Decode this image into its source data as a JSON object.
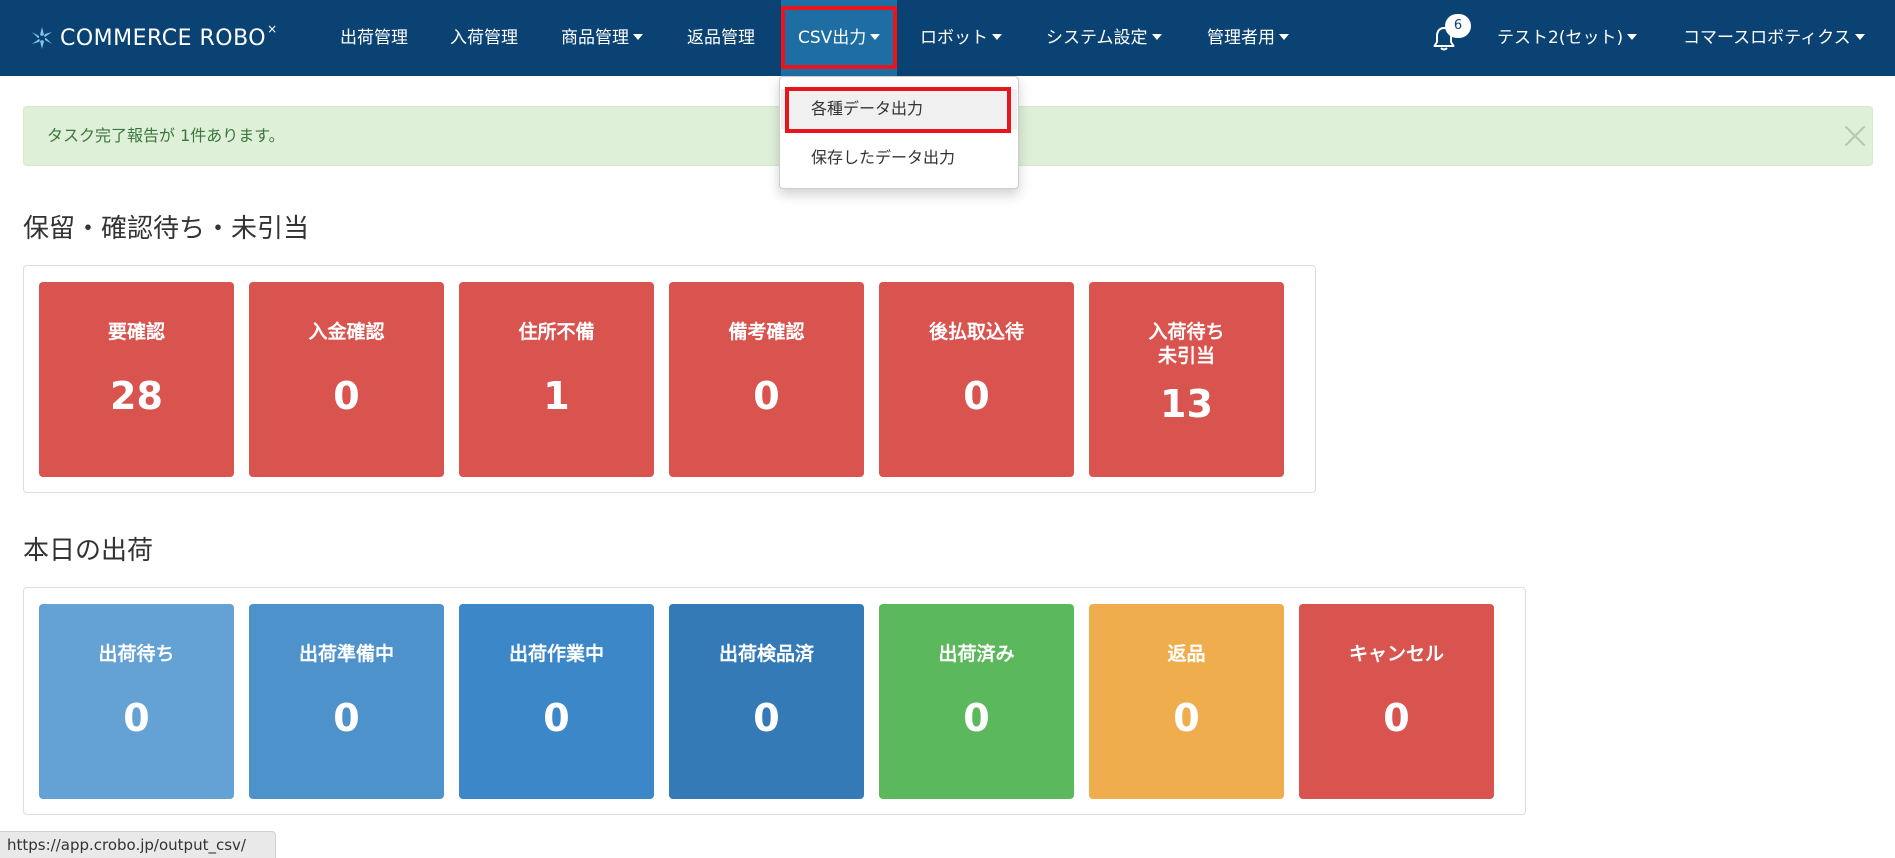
{
  "brand": {
    "name": "COMMERCE ROBO",
    "mark": "×"
  },
  "nav": {
    "items": [
      {
        "label": "出荷管理",
        "dropdown": false
      },
      {
        "label": "入荷管理",
        "dropdown": false
      },
      {
        "label": "商品管理",
        "dropdown": true
      },
      {
        "label": "返品管理",
        "dropdown": false
      },
      {
        "label": "CSV出力",
        "dropdown": true,
        "active": true
      },
      {
        "label": "ロボット",
        "dropdown": true
      },
      {
        "label": "システム設定",
        "dropdown": true
      },
      {
        "label": "管理者用",
        "dropdown": true
      }
    ],
    "notification_count": "6",
    "user": "テスト2(セット)",
    "company": "コマースロボティクス"
  },
  "csv_dropdown": {
    "items": [
      "各種データ出力",
      "保存したデータ出力"
    ]
  },
  "alert": {
    "text": "タスク完了報告が 1件あります。"
  },
  "pending_section": {
    "title": "保留・確認待ち・未引当",
    "tiles": [
      {
        "label": "要確認",
        "value": "28"
      },
      {
        "label": "入金確認",
        "value": "0"
      },
      {
        "label": "住所不備",
        "value": "1"
      },
      {
        "label": "備考確認",
        "value": "0"
      },
      {
        "label": "後払取込待",
        "value": "0"
      },
      {
        "label": "入荷待ち\n未引当",
        "value": "13"
      }
    ]
  },
  "shipping_section": {
    "title": "本日の出荷",
    "tiles": [
      {
        "label": "出荷待ち",
        "value": "0"
      },
      {
        "label": "出荷準備中",
        "value": "0"
      },
      {
        "label": "出荷作業中",
        "value": "0"
      },
      {
        "label": "出荷検品済",
        "value": "0"
      },
      {
        "label": "出荷済み",
        "value": "0"
      },
      {
        "label": "返品",
        "value": "0"
      },
      {
        "label": "キャンセル",
        "value": "0"
      }
    ]
  },
  "colors": {
    "navbar": "#0a4273",
    "nav_active": "#1f6ea3",
    "highlight": "#e8151d",
    "pending_tile": "#d9534f",
    "shipping_tiles": [
      "#64a1d4",
      "#4e92cc",
      "#3c87c7",
      "#337ab7",
      "#5cb85c",
      "#f0ad4e",
      "#d9534f"
    ]
  },
  "status_bar": {
    "url": "https://app.crobo.jp/output_csv/"
  }
}
